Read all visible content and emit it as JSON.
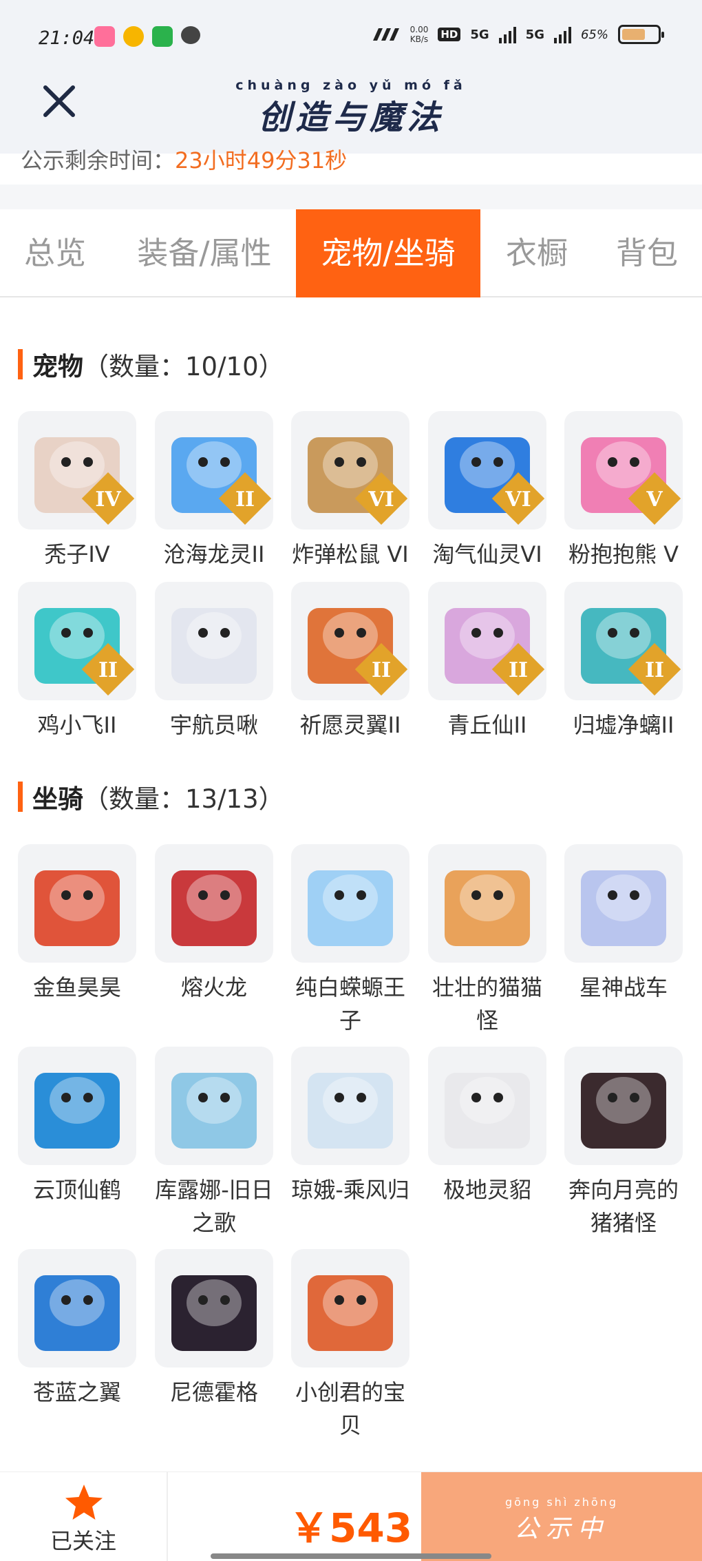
{
  "status_bar": {
    "time": "21:04",
    "net_speed": "0.00",
    "net_unit": "KB/s",
    "hd_label": "HD",
    "sim1": "5G",
    "sim2": "5G",
    "battery": "65%"
  },
  "header": {
    "title_pinyin": "chuàng zào yǔ mó fǎ",
    "title": "创造与魔法"
  },
  "countdown": {
    "label": "公示剩余时间：",
    "value": "23小时49分31秒"
  },
  "tabs": [
    {
      "label": "总览",
      "active": false
    },
    {
      "label": "装备/属性",
      "active": false
    },
    {
      "label": "宠物/坐骑",
      "active": true
    },
    {
      "label": "衣橱",
      "active": false
    },
    {
      "label": "背包",
      "active": false
    }
  ],
  "pets": {
    "title": "宠物",
    "count": "（数量：10/10）",
    "items": [
      {
        "name": "秃子IV",
        "badge": "IV",
        "color": "#e8d2c6"
      },
      {
        "name": "沧海龙灵II",
        "badge": "II",
        "color": "#5aa8f0"
      },
      {
        "name": "炸弹松鼠 VI",
        "badge": "VI",
        "color": "#c99a5c"
      },
      {
        "name": "淘气仙灵VI",
        "badge": "VI",
        "color": "#2f7ee0"
      },
      {
        "name": "粉抱抱熊 V",
        "badge": "V",
        "color": "#f07fb4"
      },
      {
        "name": "鸡小飞II",
        "badge": "II",
        "color": "#3fc7c9"
      },
      {
        "name": "宇航员啾",
        "badge": "",
        "color": "#e3e6ef"
      },
      {
        "name": "祈愿灵翼II",
        "badge": "II",
        "color": "#e0743a"
      },
      {
        "name": "青丘仙II",
        "badge": "II",
        "color": "#d9a7dd"
      },
      {
        "name": "归墟净螭II",
        "badge": "II",
        "color": "#46b8c0"
      }
    ]
  },
  "mounts": {
    "title": "坐骑",
    "count": "（数量：13/13）",
    "items": [
      {
        "name": "金鱼昊昊",
        "color": "#e0543a"
      },
      {
        "name": "熔火龙",
        "color": "#c9393c"
      },
      {
        "name": "纯白蝾螈王子",
        "color": "#9fd0f5"
      },
      {
        "name": "壮壮的猫猫怪",
        "color": "#e9a25a"
      },
      {
        "name": "星神战车",
        "color": "#b9c5ee"
      },
      {
        "name": "云顶仙鹤",
        "color": "#2a8ed8"
      },
      {
        "name": "库露娜-旧日之歌",
        "color": "#8fc8e6"
      },
      {
        "name": "琼娥-乘风归",
        "color": "#d4e4f2"
      },
      {
        "name": "极地灵貂",
        "color": "#e9e9ec"
      },
      {
        "name": "奔向月亮的猪猪怪",
        "color": "#3b2a2e"
      },
      {
        "name": "苍蓝之翼",
        "color": "#2f7fd6"
      },
      {
        "name": "尼德霍格",
        "color": "#2b2230"
      },
      {
        "name": "小创君的宝贝",
        "color": "#e0683a"
      }
    ]
  },
  "bottom": {
    "follow_label": "已关注",
    "price": "￥543",
    "status_pinyin": "gōng shì zhōng",
    "status_text": "公示中"
  }
}
